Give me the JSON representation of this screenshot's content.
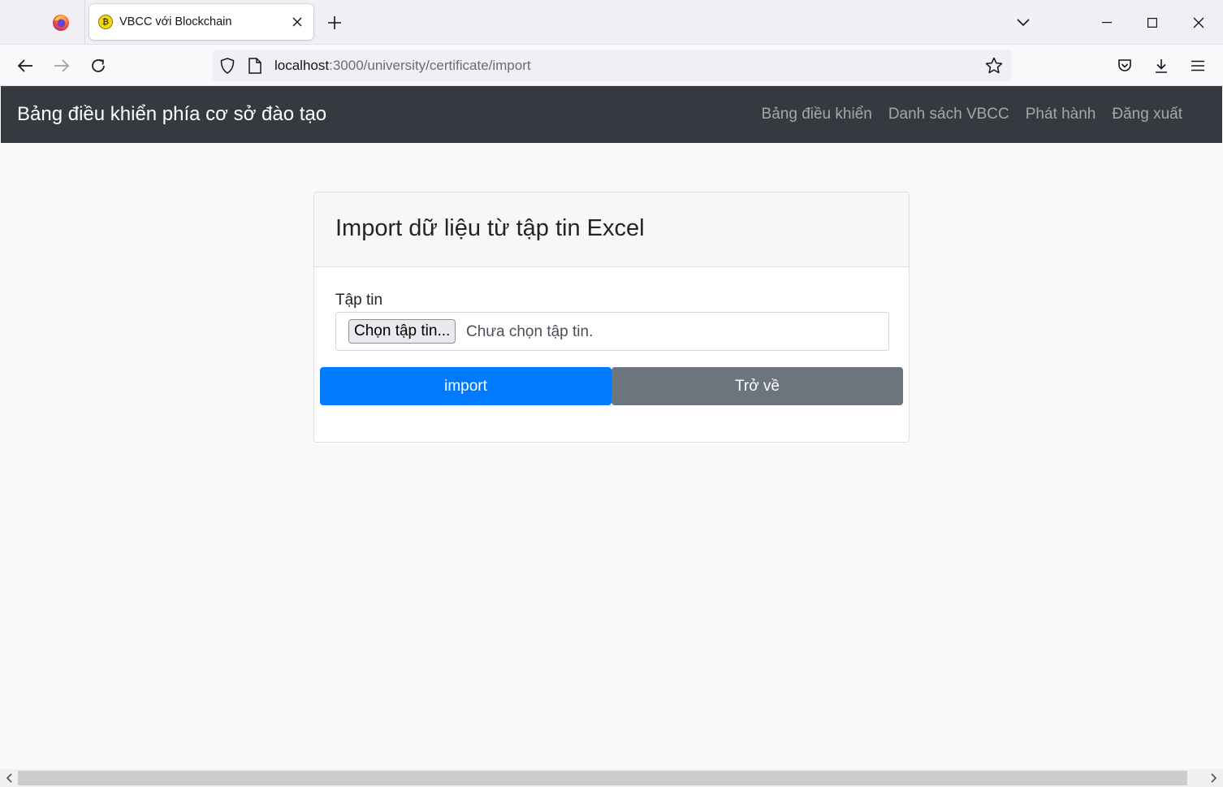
{
  "browser": {
    "tab": {
      "title": "VBCC với Blockchain"
    },
    "url": {
      "host": "localhost",
      "path": ":3000/university/certificate/import"
    }
  },
  "app": {
    "brand": "Bảng điều khiển phía cơ sở đào tạo",
    "nav": [
      {
        "label": "Bảng điều khiển"
      },
      {
        "label": "Danh sách VBCC"
      },
      {
        "label": "Phát hành"
      },
      {
        "label": "Đăng xuất"
      }
    ]
  },
  "form": {
    "title": "Import dữ liệu từ tập tin Excel",
    "file_label": "Tập tin",
    "choose_button": "Chọn tập tin...",
    "no_file_text": "Chưa chọn tập tin.",
    "import_button": "import",
    "back_button": "Trở về"
  },
  "colors": {
    "navbar_bg": "#343a40",
    "primary": "#007bff",
    "secondary": "#6c757d"
  }
}
